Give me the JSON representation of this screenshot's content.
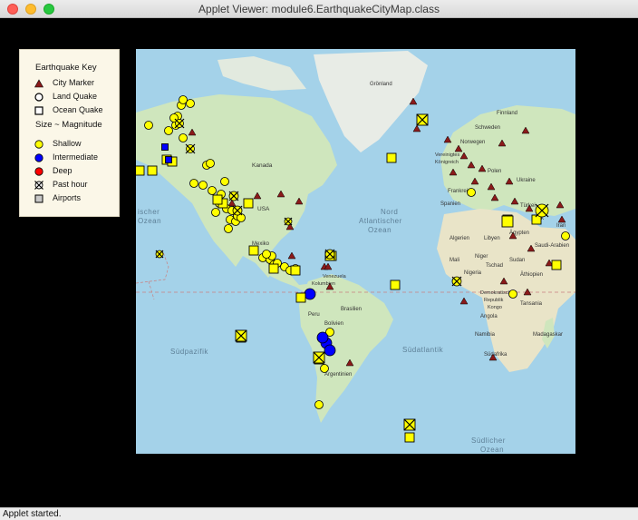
{
  "window": {
    "title": "Applet Viewer: module6.EarthquakeCityMap.class"
  },
  "status": {
    "text": "Applet started."
  },
  "key": {
    "title": "Earthquake Key",
    "items": [
      {
        "label": "City Marker",
        "icon": "triangle-icon",
        "color": "#8b1a1a"
      },
      {
        "label": "Land Quake",
        "icon": "circle-outline-icon"
      },
      {
        "label": "Ocean Quake",
        "icon": "square-outline-icon"
      }
    ],
    "size_title": "Size ~ Magnitude",
    "depth_items": [
      {
        "label": "Shallow",
        "icon": "yellow-circle-icon",
        "color": "#ffff00"
      },
      {
        "label": "Intermediate",
        "icon": "blue-circle-icon",
        "color": "#0000ff"
      },
      {
        "label": "Deep",
        "icon": "red-circle-icon",
        "color": "#ff0000"
      },
      {
        "label": "Past hour",
        "icon": "crossed-circle-icon"
      },
      {
        "label": "Airports",
        "icon": "gray-square-icon",
        "color": "#c8c8c8"
      }
    ]
  },
  "map": {
    "labels": {
      "groenland": "Grönland",
      "finnland": "Finnland",
      "schweden": "Schweden",
      "norwegen": "Norwegen",
      "vk": "Vereinigtes",
      "vk2": "Königreich",
      "polen": "Polen",
      "ukraine": "Ukraine",
      "frankreich": "Frankreich",
      "spanien": "Spanien",
      "tuerkei": "Türkei",
      "irak": "Irak",
      "iran": "Iran",
      "kanada": "Kanada",
      "usa": "USA",
      "mexiko": "Mexiko",
      "venezuela": "Venezuela",
      "kolumbien": "Kolumbien",
      "peru": "Peru",
      "brasilien": "Brasilien",
      "bolivien": "Bolivien",
      "argentinien": "Argentinien",
      "algerien": "Algerien",
      "libyen": "Libyen",
      "aegypten": "Ägypten",
      "saudi": "Saudi-Arabien",
      "mali": "Mali",
      "niger": "Niger",
      "tschad": "Tschad",
      "sudan": "Sudan",
      "nigeria": "Nigeria",
      "aethiopien": "Äthiopien",
      "drk1": "Demokratische",
      "drk2": "Republik",
      "drk3": "Kongo",
      "tansania": "Tansania",
      "angola": "Angola",
      "namibia": "Namibia",
      "madagaskar": "Madagaskar",
      "suedafrika": "Südafrika",
      "nordatl1": "Nord",
      "nordatl2": "Atlantischer",
      "nordatl3": "Ozean",
      "suedatl": "Südatlantik",
      "suedpazifik": "Südpazifik",
      "pazifik1": "ischer",
      "pazifik2": "Ozean",
      "suedozean1": "Südlicher",
      "suedozean2": "Ozean"
    }
  }
}
